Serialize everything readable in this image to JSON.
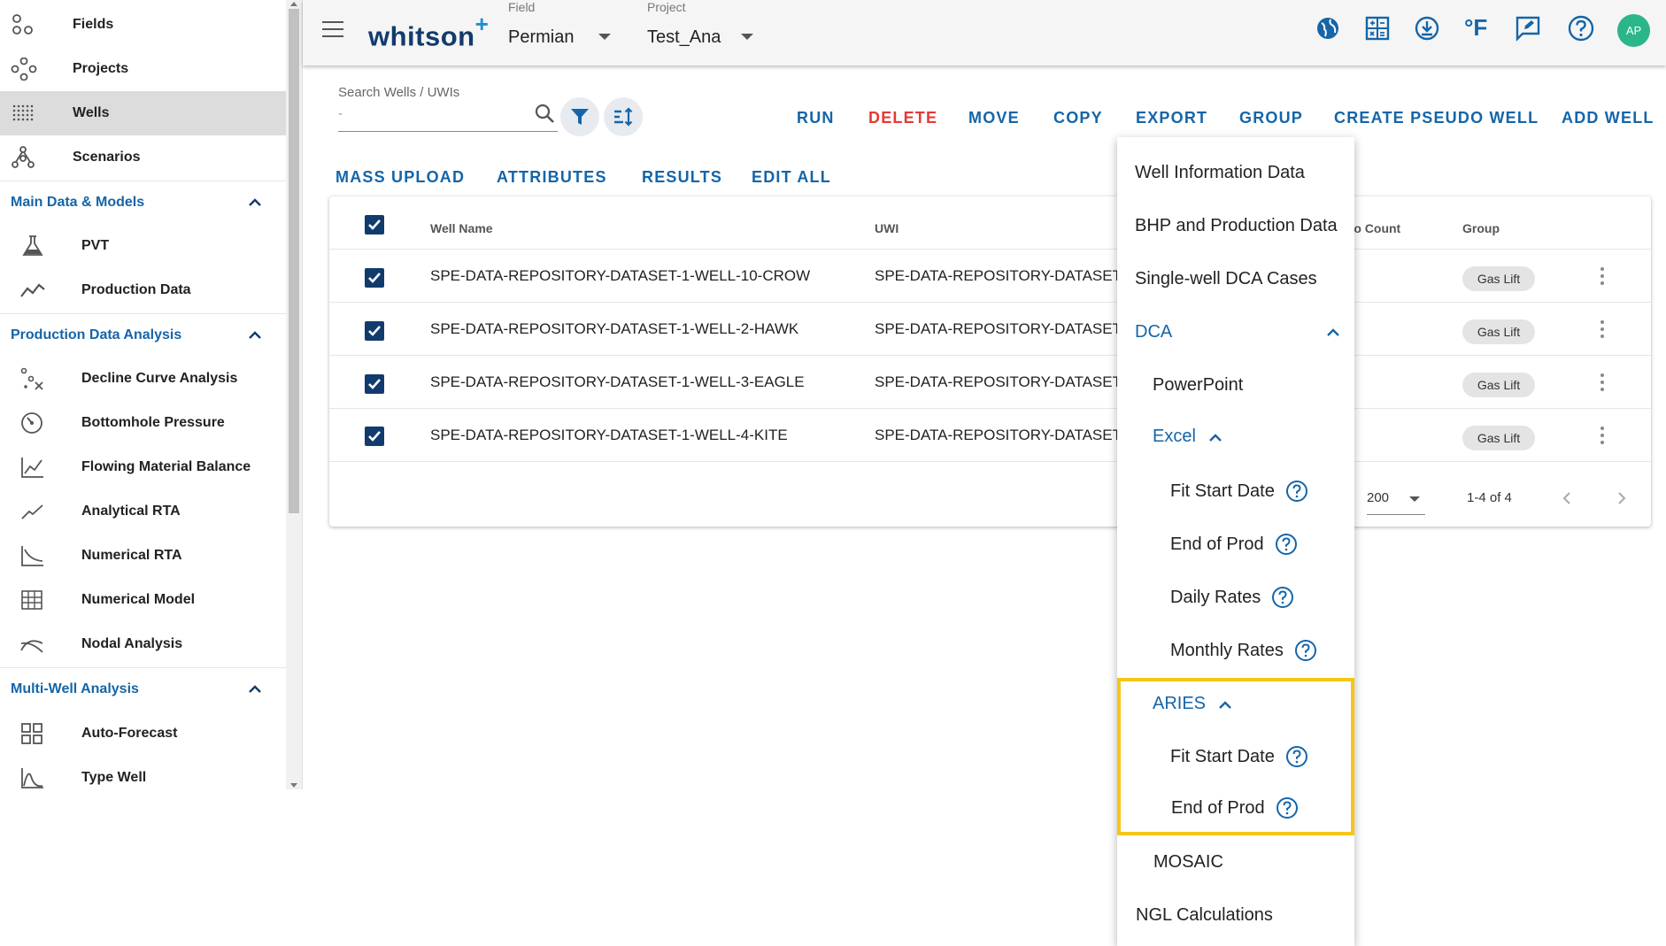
{
  "sidebar": {
    "top_items": [
      {
        "label": "Fields",
        "icon": "fields-icon"
      },
      {
        "label": "Projects",
        "icon": "projects-icon"
      },
      {
        "label": "Wells",
        "icon": "wells-icon"
      },
      {
        "label": "Scenarios",
        "icon": "scenarios-icon"
      }
    ],
    "sections": [
      {
        "title": "Main Data & Models",
        "items": [
          {
            "label": "PVT",
            "icon": "flask-icon"
          },
          {
            "label": "Production Data",
            "icon": "trend-icon"
          }
        ]
      },
      {
        "title": "Production Data Analysis",
        "items": [
          {
            "label": "Decline Curve Analysis",
            "icon": "decline-icon"
          },
          {
            "label": "Bottomhole Pressure",
            "icon": "gauge-icon"
          },
          {
            "label": "Flowing Material Balance",
            "icon": "chart-axes-icon"
          },
          {
            "label": "Analytical RTA",
            "icon": "line-icon"
          },
          {
            "label": "Numerical RTA",
            "icon": "curve-icon"
          },
          {
            "label": "Numerical Model",
            "icon": "grid-icon"
          },
          {
            "label": "Nodal Analysis",
            "icon": "nodal-icon"
          }
        ]
      },
      {
        "title": "Multi-Well Analysis",
        "items": [
          {
            "label": "Auto-Forecast",
            "icon": "dashboard-icon"
          },
          {
            "label": "Type Well",
            "icon": "typewell-icon"
          }
        ]
      }
    ]
  },
  "header": {
    "logo": "whitson",
    "logo_plus": "+",
    "field_caption": "Field",
    "field_value": "Permian",
    "project_caption": "Project",
    "project_value": "Test_Ana",
    "unit_label": "°F",
    "avatar_initials": "AP"
  },
  "search": {
    "caption": "Search Wells / UWIs",
    "value": "-"
  },
  "toolbar": {
    "run": "RUN",
    "delete": "DELETE",
    "move": "MOVE",
    "copy": "COPY",
    "export": "EXPORT",
    "group": "GROUP",
    "create_pseudo": "CREATE PSEUDO WELL",
    "add_well": "ADD WELL",
    "mass_upload": "MASS UPLOAD",
    "attributes": "ATTRIBUTES",
    "results": "RESULTS",
    "edit_all": "EDIT ALL"
  },
  "table": {
    "columns": {
      "well_name": "Well Name",
      "uwi": "UWI",
      "scenario_count": "rio Count",
      "group": "Group"
    },
    "rows": [
      {
        "well_name": "SPE-DATA-REPOSITORY-DATASET-1-WELL-10-CROW",
        "uwi": "SPE-DATA-REPOSITORY-DATASET-1",
        "group": "Gas Lift"
      },
      {
        "well_name": "SPE-DATA-REPOSITORY-DATASET-1-WELL-2-HAWK",
        "uwi": "SPE-DATA-REPOSITORY-DATASET-1",
        "group": "Gas Lift"
      },
      {
        "well_name": "SPE-DATA-REPOSITORY-DATASET-1-WELL-3-EAGLE",
        "uwi": "SPE-DATA-REPOSITORY-DATASET-1",
        "group": "Gas Lift"
      },
      {
        "well_name": "SPE-DATA-REPOSITORY-DATASET-1-WELL-4-KITE",
        "uwi": "SPE-DATA-REPOSITORY-DATASET-1",
        "group": "Gas Lift"
      }
    ],
    "pagination": {
      "rows_per_page": "200",
      "range": "1-4 of 4"
    }
  },
  "export_menu": {
    "well_info": "Well Information Data",
    "bhp_prod": "BHP and Production Data",
    "single_dca": "Single-well DCA Cases",
    "dca": "DCA",
    "powerpoint": "PowerPoint",
    "excel": "Excel",
    "excel_fit_start": "Fit Start Date",
    "excel_end_prod": "End of Prod",
    "excel_daily": "Daily Rates",
    "excel_monthly": "Monthly Rates",
    "aries": "ARIES",
    "aries_fit_start": "Fit Start Date",
    "aries_end_prod": "End of Prod",
    "mosaic": "MOSAIC",
    "ngl": "NGL Calculations"
  },
  "colors": {
    "brand": "#123b6d",
    "accent": "#1565a8",
    "danger": "#e53935",
    "highlight": "#f5c518",
    "avatar": "#2bb58b"
  }
}
